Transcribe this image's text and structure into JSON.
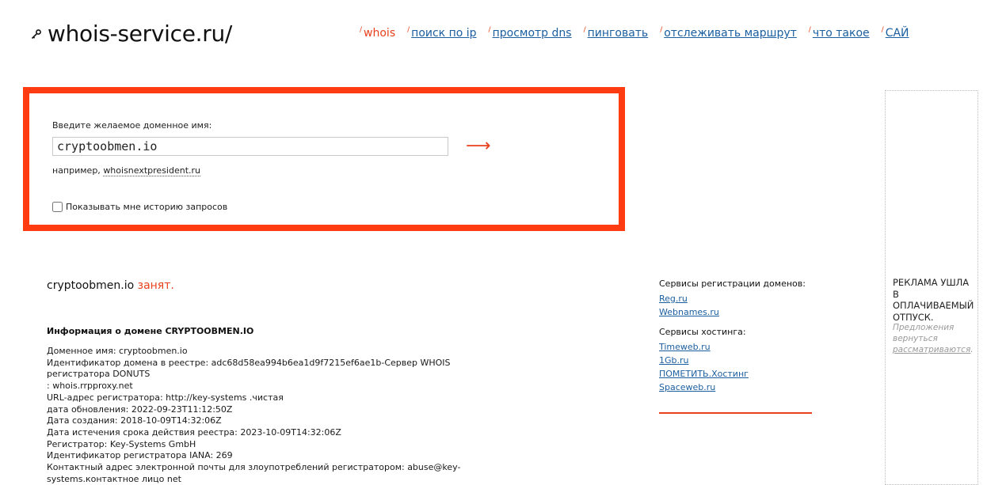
{
  "header": {
    "site_title": "whois-service.ru/",
    "nav": [
      {
        "label": "whois",
        "active": true
      },
      {
        "label": "поиск по ip",
        "active": false
      },
      {
        "label": "просмотр dns",
        "active": false
      },
      {
        "label": "пинговать",
        "active": false
      },
      {
        "label": "отслеживать маршрут",
        "active": false
      },
      {
        "label": "что такое",
        "active": false
      },
      {
        "label": "САЙ",
        "active": false
      }
    ],
    "nav_slash": "/"
  },
  "search": {
    "label": "Введите желаемое доменное имя:",
    "value": "cryptoobmen.io",
    "submit_icon": "arrow-right-icon",
    "example_prefix": "например, ",
    "example_link": "whoisnextpresident.ru",
    "history_label": "Показывать мне историю запросов",
    "history_checked": false
  },
  "result": {
    "domain": "cryptoobmen.io",
    "status": "занят."
  },
  "info": {
    "heading": "Информация о домене CRYPTOOBMEN.IO",
    "lines": [
      "Доменное имя: cryptoobmen.io",
      "Идентификатор домена в реестре: adc68d58ea994b6ea1d9f7215ef6ae1b-Сервер WHOIS",
      "регистратора DONUTS",
      ": whois.rrpproxy.net",
      "URL-адрес регистратора: http://key-systems .чистая",
      "дата обновления: 2022-09-23T11:12:50Z",
      "Дата создания: 2018-10-09T14:32:06Z",
      "Дата истечения срока действия реестра: 2023-10-09T14:32:06Z",
      "Регистратор: Key-Systems GmbH",
      "Идентификатор регистратора IANA: 269",
      "Контактный адрес электронной почты для злоупотреблений регистратором: abuse@key-",
      "systems.контактное лицо net"
    ]
  },
  "services": {
    "registration_title": "Сервисы регистрации доменов:",
    "registration_links": [
      "Reg.ru",
      "Webnames.ru"
    ],
    "hosting_title": "Сервисы хостинга:",
    "hosting_links": [
      "Timeweb.ru",
      "1Gb.ru",
      "ПОМЕТИТЬ.Хостинг",
      "Spaceweb.ru"
    ]
  },
  "ad": {
    "headline": "Реклама ушла в оплачиваемый отпуск.",
    "sub_prefix": "Предложения вернуться ",
    "sub_link": "рассматриваются",
    "sub_suffix": "."
  },
  "colors": {
    "accent": "#e8401c",
    "search_border": "#ff3c11",
    "link": "#1b5fa0"
  }
}
